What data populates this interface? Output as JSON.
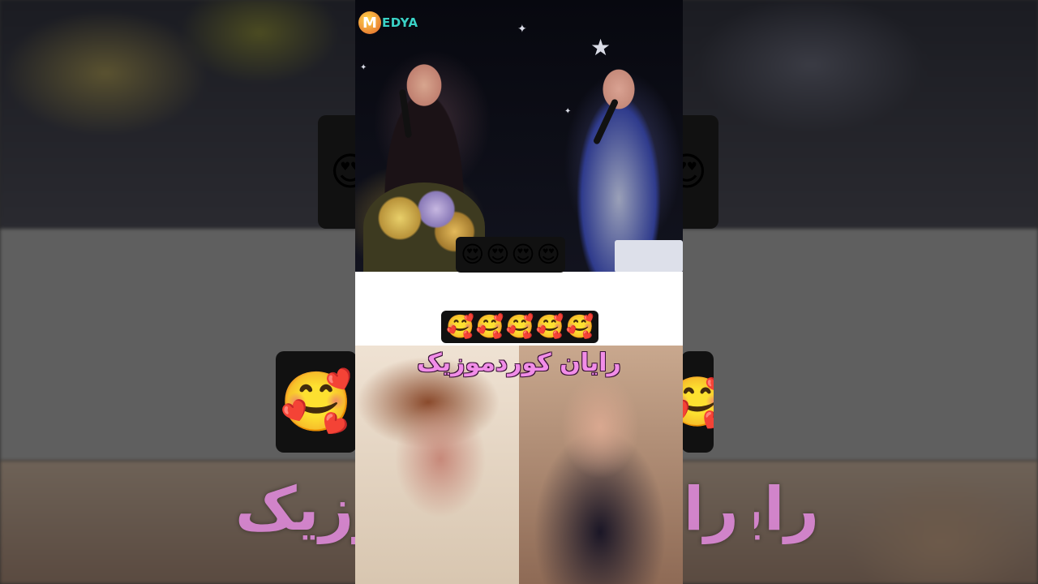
{
  "channel_logo": {
    "letter": "M",
    "text": "EDYA"
  },
  "emoji_row_top": [
    "😍",
    "😍",
    "😍",
    "😍"
  ],
  "emoji_row_mid": [
    "🥰",
    "🥰",
    "🥰",
    "🥰",
    "🥰"
  ],
  "caption": "رایان کوردموزیک",
  "background": {
    "emoji_left_top": "😍",
    "emoji_right_top": "😍",
    "emoji_left_mid": "🥰",
    "emoji_right_mid": "🥰",
    "caption_left": "رایان کوردموزیک",
    "caption_right": "رایان کوردموزیک"
  },
  "colors": {
    "caption": "#f18de8",
    "logo_text": "#3ad2c6",
    "emoji_box": "#111111",
    "panel_bg": "#ffffff"
  }
}
